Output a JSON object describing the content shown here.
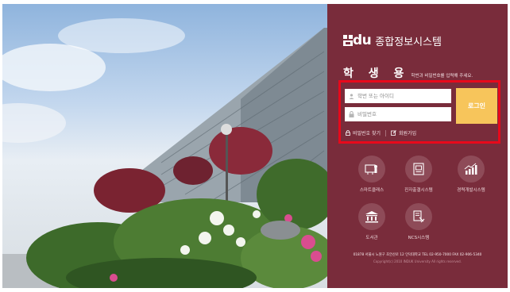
{
  "header": {
    "logo_mark": "du",
    "title": "종합정보시스템"
  },
  "login": {
    "role_label": "학 생 용",
    "hint": "학번과 비밀번호를 입력해 주세요.",
    "id_placeholder": "학번 또는 아이디",
    "pw_placeholder": "비밀번호",
    "login_button": "로그인",
    "find_password": "비밀번호 찾기",
    "signup": "회원가입"
  },
  "services": [
    {
      "label": "스마트클래스",
      "icon": "smart-class-icon"
    },
    {
      "label": "진자출결시스템",
      "icon": "attendance-icon"
    },
    {
      "label": "경력개발시스템",
      "icon": "career-chart-icon"
    },
    {
      "label": "도서관",
      "icon": "library-icon"
    },
    {
      "label": "NCS시스템",
      "icon": "ncs-icon"
    }
  ],
  "footer": {
    "address": "01878 서울시 노원구 초안산로 12 인덕대학교 TEL 02-950-7000 FAX 02-906-5340",
    "copyright": "Copyright(c) 2010 INDUK University All rights reserved."
  },
  "colors": {
    "panel": "#792c3b",
    "highlight_border": "#e8091b",
    "login_button": "#f7c55b",
    "service_circle": "#8e4b58"
  }
}
